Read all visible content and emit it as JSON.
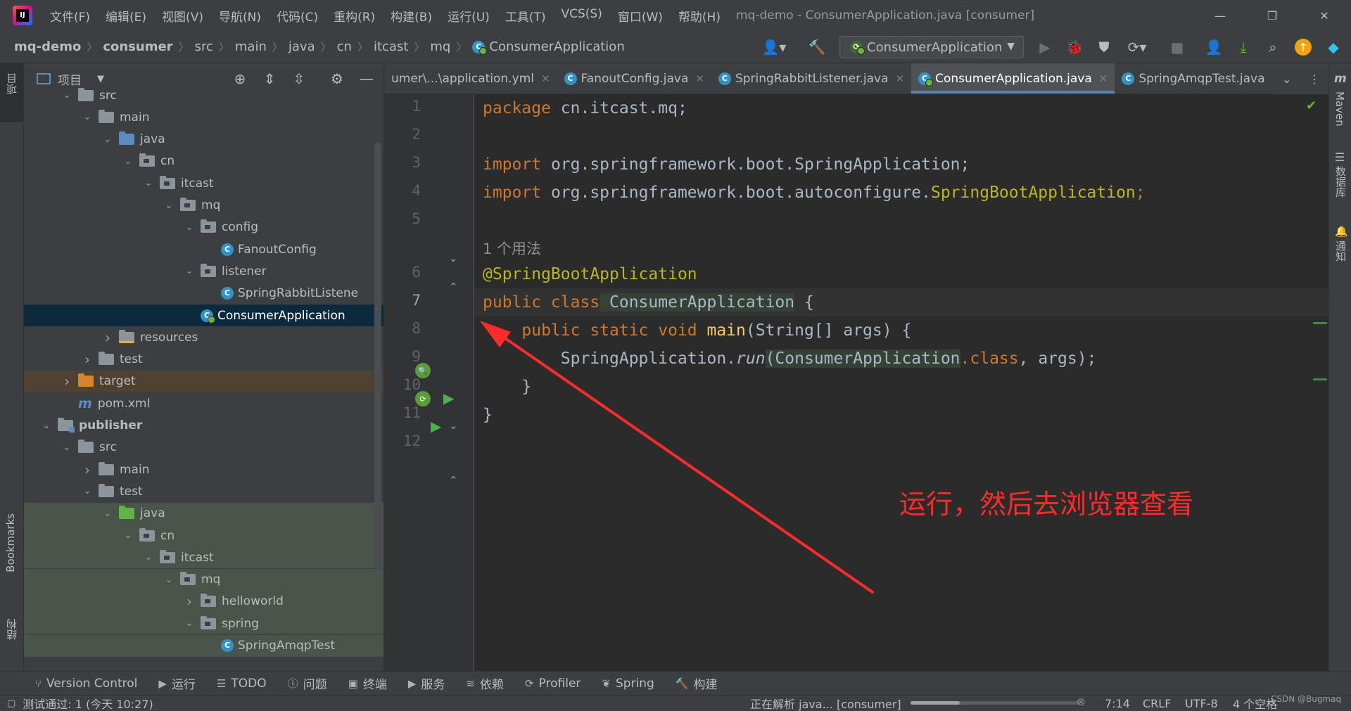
{
  "app": {
    "window_title": "mq-demo - ConsumerApplication.java [consumer]",
    "menu": [
      "文件(F)",
      "编辑(E)",
      "视图(V)",
      "导航(N)",
      "代码(C)",
      "重构(R)",
      "构建(B)",
      "运行(U)",
      "工具(T)",
      "VCS(S)",
      "窗口(W)",
      "帮助(H)"
    ]
  },
  "breadcrumb": [
    "mq-demo",
    "consumer",
    "src",
    "main",
    "java",
    "cn",
    "itcast",
    "mq",
    "ConsumerApplication"
  ],
  "run_config": "ConsumerApplication",
  "left_strip": {
    "project": "项目",
    "bookmarks": "Bookmarks",
    "structure": "结构"
  },
  "right_strip": {
    "maven": "Maven",
    "database": "数据库",
    "notifications": "通知"
  },
  "project_panel": {
    "title": "项目",
    "tree": [
      {
        "label": "src",
        "depth": 0,
        "expanded": true,
        "kind": "folder"
      },
      {
        "label": "main",
        "depth": 1,
        "expanded": true,
        "kind": "folder"
      },
      {
        "label": "java",
        "depth": 2,
        "expanded": true,
        "kind": "src"
      },
      {
        "label": "cn",
        "depth": 3,
        "expanded": true,
        "kind": "pkg"
      },
      {
        "label": "itcast",
        "depth": 4,
        "expanded": true,
        "kind": "pkg"
      },
      {
        "label": "mq",
        "depth": 5,
        "expanded": true,
        "kind": "pkg"
      },
      {
        "label": "config",
        "depth": 6,
        "expanded": true,
        "kind": "pkg"
      },
      {
        "label": "FanoutConfig",
        "depth": 7,
        "kind": "class"
      },
      {
        "label": "listener",
        "depth": 6,
        "expanded": true,
        "kind": "pkg"
      },
      {
        "label": "SpringRabbitListene",
        "depth": 7,
        "kind": "class"
      },
      {
        "label": "ConsumerApplication",
        "depth": 6,
        "kind": "springclass",
        "selected": true
      },
      {
        "label": "resources",
        "depth": 2,
        "expanded": false,
        "kind": "res"
      },
      {
        "label": "test",
        "depth": 1,
        "expanded": false,
        "kind": "folder"
      },
      {
        "label": "target",
        "depth": 0,
        "expanded": false,
        "kind": "target",
        "highlight": "target"
      },
      {
        "label": "pom.xml",
        "depth": 0,
        "kind": "maven"
      },
      {
        "label": "publisher",
        "depth": -1,
        "expanded": true,
        "kind": "mod",
        "bold": true
      },
      {
        "label": "src",
        "depth": 0,
        "expanded": true,
        "kind": "folder"
      },
      {
        "label": "main",
        "depth": 1,
        "expanded": false,
        "kind": "folder"
      },
      {
        "label": "test",
        "depth": 1,
        "expanded": true,
        "kind": "folder"
      },
      {
        "label": "java",
        "depth": 2,
        "expanded": true,
        "kind": "test",
        "highlight": "test"
      },
      {
        "label": "cn",
        "depth": 3,
        "expanded": true,
        "kind": "pkg",
        "highlight": "test"
      },
      {
        "label": "itcast",
        "depth": 4,
        "expanded": true,
        "kind": "pkg",
        "highlight": "test"
      },
      {
        "label": "mq",
        "depth": 5,
        "expanded": true,
        "kind": "pkg",
        "highlight": "test"
      },
      {
        "label": "helloworld",
        "depth": 6,
        "expanded": false,
        "kind": "pkg",
        "highlight": "test"
      },
      {
        "label": "spring",
        "depth": 6,
        "expanded": true,
        "kind": "pkg",
        "highlight": "test"
      },
      {
        "label": "SpringAmqpTest",
        "depth": 7,
        "kind": "class",
        "highlight": "test"
      }
    ]
  },
  "tabs": [
    {
      "label": "umer\\...\\application.yml",
      "icon": "yml"
    },
    {
      "label": "FanoutConfig.java",
      "icon": "class"
    },
    {
      "label": "SpringRabbitListener.java",
      "icon": "class"
    },
    {
      "label": "ConsumerApplication.java",
      "icon": "springclass",
      "active": true
    },
    {
      "label": "SpringAmqpTest.java",
      "icon": "class"
    }
  ],
  "editor": {
    "line_numbers": [
      "1",
      "2",
      "3",
      "4",
      "5",
      "6",
      "7",
      "8",
      "9",
      "10",
      "11",
      "12"
    ],
    "usage_hint": "1 个用法",
    "code": {
      "l1_kw": "package",
      "l1_rest": " cn.itcast.mq;",
      "l3_kw": "import",
      "l3_rest": " org.springframework.boot.SpringApplication;",
      "l4_kw": "import",
      "l4_rest": " org.springframework.boot.autoconfigure.",
      "l4_ann": "SpringBootApplication",
      "l4_end": ";",
      "l6_ann": "@SpringBootApplication",
      "l7_kw": "public class",
      "l7_cls": " ConsumerApplication",
      "l7_end": " {",
      "l8_kw": "    public static void",
      "l8_fn": " main",
      "l8_rest": "(String[] args) {",
      "l9_a": "        SpringApplication.",
      "l9_fn": "run",
      "l9_b": "(ConsumerApplication",
      "l9_kw": ".class",
      "l9_c": ", args);",
      "l10": "    }",
      "l11": "}"
    },
    "annotation_text": "运行，然后去浏览器查看",
    "annotation_color": "#ff2a2a"
  },
  "bottom_tools": [
    "Version Control",
    "运行",
    "TODO",
    "问题",
    "终端",
    "服务",
    "依赖",
    "Profiler",
    "Spring",
    "构建"
  ],
  "status": {
    "left": "测试通过: 1 (今天 10:27)",
    "progress_text": "正在解析 java... [consumer]",
    "position": "7:14",
    "line_sep": "CRLF",
    "encoding": "UTF-8",
    "indent": "4 个空格",
    "watermark": "CSDN @Bugmaq"
  }
}
